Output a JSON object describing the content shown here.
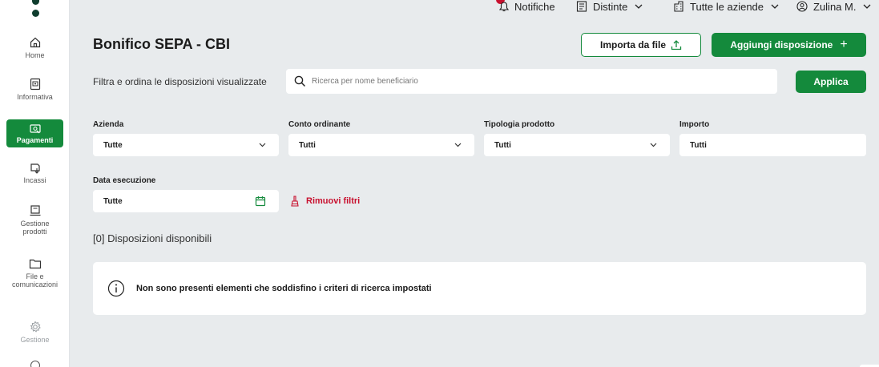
{
  "sidebar": {
    "items": [
      {
        "label": "Home",
        "icon": "home-icon"
      },
      {
        "label": "Informativa",
        "icon": "info-doc-icon"
      },
      {
        "label": "Pagamenti",
        "icon": "payments-icon"
      },
      {
        "label": "Incassi",
        "icon": "collections-icon"
      },
      {
        "label": "Gestione prodotti",
        "icon": "products-icon"
      },
      {
        "label": "File e comunicazioni",
        "icon": "folder-icon"
      },
      {
        "label": "Gestione",
        "icon": "gear-icon"
      }
    ]
  },
  "topbar": {
    "notifications": "Notifiche",
    "distinte": "Distinte",
    "companies": "Tutte le aziende",
    "user": "Zulina M."
  },
  "page": {
    "title": "Bonifico SEPA - CBI",
    "import_button": "Importa da file",
    "add_button": "Aggiungi disposizione",
    "add_button_plus": "+"
  },
  "filter": {
    "label": "Filtra e ordina le disposizioni visualizzate",
    "search_placeholder": "Ricerca per nome beneficiario",
    "apply_button": "Applica"
  },
  "fields": {
    "azienda": {
      "label": "Azienda",
      "value": "Tutte"
    },
    "conto": {
      "label": "Conto ordinante",
      "value": "Tutti"
    },
    "tipologia": {
      "label": "Tipologia prodotto",
      "value": "Tutti"
    },
    "importo": {
      "label": "Importo",
      "value": "Tutti"
    },
    "data": {
      "label": "Data esecuzione",
      "value": "Tutte"
    }
  },
  "remove_filters": "Rimuovi filtri",
  "results": {
    "count_text": "[0] Disposizioni disponibili",
    "empty_message": "Non sono presenti elementi che soddisfino i criteri di ricerca impostati"
  },
  "colors": {
    "accent": "#148a3c",
    "danger": "#c8102e",
    "background": "#e8ebed"
  }
}
